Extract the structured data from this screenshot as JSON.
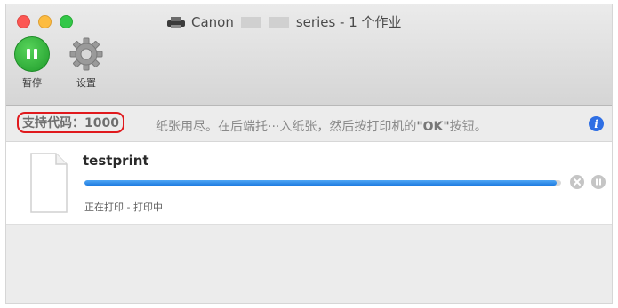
{
  "window": {
    "title_prefix": "Canon",
    "title_suffix": "series - 1 个作业"
  },
  "toolbar": {
    "pause_label": "暂停",
    "settings_label": "设置"
  },
  "status": {
    "code_text": "支持代码：1000",
    "message_pre": "纸张用尽。在后端托···入纸张，然后按打印机的",
    "message_key": "\"OK\"",
    "message_post": "按钮。"
  },
  "job": {
    "name": "testprint",
    "status_text": "正在打印 - 打印中",
    "progress_fraction": 0.99
  },
  "colors": {
    "accent": "#1e7be0",
    "highlight_border": "#e0191d",
    "pause_green": "#1f9b2b",
    "info_blue": "#2f6fe4"
  },
  "icons": [
    "printer-icon",
    "pause-icon",
    "gear-icon",
    "info-icon",
    "document-icon",
    "cancel-job-icon",
    "hold-job-icon"
  ]
}
